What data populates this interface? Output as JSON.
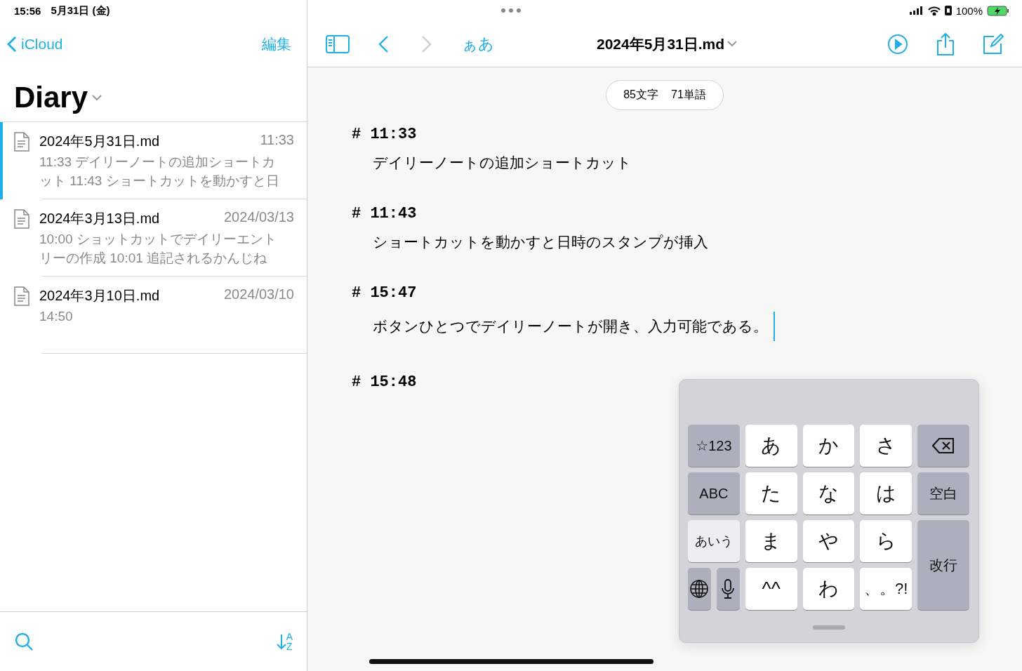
{
  "status_bar": {
    "time": "15:56",
    "date": "5月31日 (金)",
    "battery": "100%"
  },
  "sidebar": {
    "back_label": "iCloud",
    "edit_label": "編集",
    "title": "Diary",
    "files": [
      {
        "name": "2024年5月31日.md",
        "date": "11:33",
        "preview": "11:33 デイリーノートの追加ショートカット 11:43 ショートカットを動かすと日",
        "selected": true
      },
      {
        "name": "2024年3月13日.md",
        "date": "2024/03/13",
        "preview": "10:00 ショットカットでデイリーエントリーの作成 10:01 追記されるかんじね",
        "selected": false
      },
      {
        "name": "2024年3月10日.md",
        "date": "2024/03/10",
        "preview": "14:50",
        "selected": false
      }
    ],
    "sort": {
      "top": "A",
      "bottom": "Z"
    }
  },
  "toolbar": {
    "font_label": "ぁあ",
    "doc_title": "2024年5月31日.md"
  },
  "counts": {
    "chars": "85文字",
    "words": "71単語"
  },
  "blocks": [
    {
      "heading": "# 11:33",
      "body": "デイリーノートの追加ショートカット",
      "cursor": false
    },
    {
      "heading": "# 11:43",
      "body": "ショートカットを動かすと日時のスタンプが挿入",
      "cursor": false
    },
    {
      "heading": "# 15:47",
      "body": "ボタンひとつでデイリーノートが開き、入力可能である。",
      "cursor": true
    },
    {
      "heading": "# 15:48",
      "cursor": false
    }
  ],
  "keyboard": {
    "keys": [
      {
        "kind": "function",
        "label": "☆123"
      },
      {
        "kind": "letter",
        "label": "あ"
      },
      {
        "kind": "letter",
        "label": "か"
      },
      {
        "kind": "letter",
        "label": "さ"
      },
      {
        "kind": "delete"
      },
      {
        "kind": "function",
        "label": "ABC"
      },
      {
        "kind": "letter",
        "label": "た"
      },
      {
        "kind": "letter",
        "label": "な"
      },
      {
        "kind": "letter",
        "label": "は"
      },
      {
        "kind": "function",
        "label": "空白"
      },
      {
        "kind": "mode",
        "label": "あいう",
        "selected": true
      },
      {
        "kind": "letter",
        "label": "ま"
      },
      {
        "kind": "letter",
        "label": "や"
      },
      {
        "kind": "letter",
        "label": "ら"
      },
      {
        "kind": "tall",
        "label": "改行"
      },
      {
        "kind": "globe"
      },
      {
        "kind": "mic"
      },
      {
        "kind": "letter",
        "label": "^^"
      },
      {
        "kind": "letter",
        "label": "わ"
      },
      {
        "kind": "letter",
        "label": "、。?!"
      }
    ]
  }
}
